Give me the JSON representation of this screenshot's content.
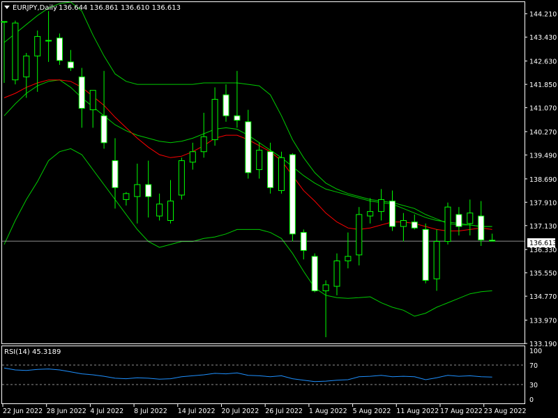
{
  "symbol_label": "EURJPY,Daily",
  "ohlc_readout": "136.644 136.861 136.610 136.613",
  "current_price_label": "136.613",
  "rsi_label": "RSI(14) 45.3189",
  "colors": {
    "background": "#000000",
    "foreground": "#ffffff",
    "bull_body": "#000000",
    "bear_body": "#ffffff",
    "wick": "#00ff00",
    "bollinger": "#00cc00",
    "moving_average": "#ff0000",
    "rsi_line": "#1e90ff",
    "price_line": "#c0c0c0",
    "rsi_levels": "#c0c0c0"
  },
  "chart_data": [
    {
      "type": "candlestick",
      "title": "EURJPY,Daily",
      "ylim": [
        133.19,
        144.6
      ],
      "y_ticks": [
        "144.210",
        "143.430",
        "142.630",
        "141.850",
        "141.070",
        "140.270",
        "139.490",
        "138.690",
        "137.910",
        "137.130",
        "136.330",
        "135.550",
        "134.770",
        "133.970",
        "133.190"
      ],
      "x_ticks": [
        "22 Jun 2022",
        "28 Jun 2022",
        "4 Jul 2022",
        "8 Jul 2022",
        "14 Jul 2022",
        "20 Jul 2022",
        "26 Jul 2022",
        "1 Aug 2022",
        "5 Aug 2022",
        "11 Aug 2022",
        "17 Aug 2022",
        "23 Aug 2022"
      ],
      "candles": [
        {
          "o": 143.95,
          "h": 143.95,
          "l": 141.9,
          "c": 143.95
        },
        {
          "o": 142.0,
          "h": 143.98,
          "l": 141.85,
          "c": 143.9
        },
        {
          "o": 142.1,
          "h": 142.9,
          "l": 141.4,
          "c": 142.8
        },
        {
          "o": 142.8,
          "h": 143.65,
          "l": 141.6,
          "c": 143.45
        },
        {
          "o": 143.3,
          "h": 144.3,
          "l": 142.6,
          "c": 143.32
        },
        {
          "o": 143.4,
          "h": 143.55,
          "l": 142.5,
          "c": 142.65
        },
        {
          "o": 142.6,
          "h": 143.0,
          "l": 142.3,
          "c": 142.4
        },
        {
          "o": 142.1,
          "h": 142.4,
          "l": 140.4,
          "c": 141.05
        },
        {
          "o": 141.0,
          "h": 141.6,
          "l": 140.4,
          "c": 141.65
        },
        {
          "o": 140.8,
          "h": 142.3,
          "l": 139.7,
          "c": 139.9
        },
        {
          "o": 139.3,
          "h": 140.05,
          "l": 137.7,
          "c": 138.4
        },
        {
          "o": 138.0,
          "h": 138.25,
          "l": 137.8,
          "c": 138.2
        },
        {
          "o": 138.1,
          "h": 139.2,
          "l": 137.2,
          "c": 138.5
        },
        {
          "o": 138.5,
          "h": 139.3,
          "l": 137.4,
          "c": 138.1
        },
        {
          "o": 137.45,
          "h": 138.2,
          "l": 137.3,
          "c": 137.85
        },
        {
          "o": 137.3,
          "h": 138.65,
          "l": 137.2,
          "c": 137.95
        },
        {
          "o": 138.15,
          "h": 139.4,
          "l": 138.0,
          "c": 139.3
        },
        {
          "o": 139.25,
          "h": 139.9,
          "l": 139.0,
          "c": 139.6
        },
        {
          "o": 139.6,
          "h": 140.9,
          "l": 139.4,
          "c": 140.1
        },
        {
          "o": 140.0,
          "h": 141.75,
          "l": 139.8,
          "c": 141.35
        },
        {
          "o": 141.5,
          "h": 141.85,
          "l": 140.6,
          "c": 140.8
        },
        {
          "o": 140.8,
          "h": 142.3,
          "l": 140.4,
          "c": 140.65
        },
        {
          "o": 140.6,
          "h": 141.0,
          "l": 138.7,
          "c": 138.9
        },
        {
          "o": 139.0,
          "h": 139.9,
          "l": 138.7,
          "c": 139.65
        },
        {
          "o": 139.6,
          "h": 139.9,
          "l": 138.2,
          "c": 138.4
        },
        {
          "o": 138.3,
          "h": 139.6,
          "l": 138.2,
          "c": 139.4
        },
        {
          "o": 139.5,
          "h": 139.55,
          "l": 136.6,
          "c": 136.85
        },
        {
          "o": 136.9,
          "h": 137.0,
          "l": 136.0,
          "c": 136.3
        },
        {
          "o": 136.1,
          "h": 136.2,
          "l": 134.9,
          "c": 134.95
        },
        {
          "o": 134.95,
          "h": 135.3,
          "l": 133.4,
          "c": 135.15
        },
        {
          "o": 135.1,
          "h": 136.2,
          "l": 134.8,
          "c": 135.95
        },
        {
          "o": 135.95,
          "h": 136.9,
          "l": 135.7,
          "c": 136.1
        },
        {
          "o": 136.15,
          "h": 137.75,
          "l": 135.8,
          "c": 137.5
        },
        {
          "o": 137.45,
          "h": 138.05,
          "l": 137.2,
          "c": 137.6
        },
        {
          "o": 137.6,
          "h": 138.35,
          "l": 137.3,
          "c": 138.0
        },
        {
          "o": 137.95,
          "h": 138.3,
          "l": 136.95,
          "c": 137.1
        },
        {
          "o": 137.1,
          "h": 137.55,
          "l": 136.6,
          "c": 137.3
        },
        {
          "o": 137.25,
          "h": 137.5,
          "l": 137.0,
          "c": 137.05
        },
        {
          "o": 137.0,
          "h": 137.2,
          "l": 135.2,
          "c": 135.3
        },
        {
          "o": 135.35,
          "h": 137.0,
          "l": 134.95,
          "c": 136.6
        },
        {
          "o": 136.6,
          "h": 137.9,
          "l": 136.5,
          "c": 137.75
        },
        {
          "o": 137.5,
          "h": 137.75,
          "l": 136.8,
          "c": 137.1
        },
        {
          "o": 137.2,
          "h": 138.0,
          "l": 136.8,
          "c": 137.55
        },
        {
          "o": 137.45,
          "h": 137.95,
          "l": 136.45,
          "c": 136.65
        },
        {
          "o": 136.64,
          "h": 136.86,
          "l": 136.61,
          "c": 136.61
        }
      ],
      "moving_average": [
        141.4,
        141.55,
        141.75,
        141.9,
        142.0,
        142.0,
        141.95,
        141.75,
        141.45,
        141.15,
        140.75,
        140.4,
        140.05,
        139.75,
        139.5,
        139.4,
        139.45,
        139.6,
        139.8,
        140.05,
        140.15,
        140.15,
        140.0,
        139.8,
        139.6,
        139.3,
        138.8,
        138.3,
        137.95,
        137.55,
        137.25,
        137.05,
        137.0,
        137.05,
        137.15,
        137.25,
        137.25,
        137.2,
        137.1,
        137.0,
        136.95,
        136.95,
        137.0,
        137.05,
        137.0
      ],
      "bollinger_upper": [
        143.25,
        143.55,
        143.85,
        144.15,
        144.4,
        144.55,
        144.6,
        144.3,
        143.5,
        142.8,
        142.2,
        141.95,
        141.85,
        141.85,
        141.85,
        141.85,
        141.85,
        141.85,
        141.9,
        141.9,
        141.9,
        141.9,
        141.85,
        141.8,
        141.5,
        140.8,
        140.0,
        139.4,
        138.9,
        138.55,
        138.35,
        138.2,
        138.1,
        138.0,
        137.95,
        137.9,
        137.8,
        137.7,
        137.5,
        137.35,
        137.2,
        137.15,
        137.15,
        137.1,
        137.1
      ],
      "bollinger_middle": [
        140.8,
        141.2,
        141.55,
        141.8,
        141.95,
        142.0,
        141.75,
        141.4,
        141.1,
        140.8,
        140.5,
        140.3,
        140.15,
        140.05,
        139.95,
        139.9,
        139.95,
        140.05,
        140.2,
        140.35,
        140.4,
        140.35,
        140.15,
        139.9,
        139.65,
        139.4,
        139.1,
        138.8,
        138.55,
        138.35,
        138.25,
        138.15,
        138.05,
        137.95,
        137.9,
        137.85,
        137.7,
        137.55,
        137.4,
        137.3,
        137.25,
        137.2,
        137.15,
        137.1,
        137.1
      ],
      "bollinger_lower": [
        136.5,
        137.3,
        138.0,
        138.6,
        139.3,
        139.6,
        139.7,
        139.5,
        139.0,
        138.5,
        138.0,
        137.5,
        137.0,
        136.6,
        136.4,
        136.5,
        136.6,
        136.6,
        136.7,
        136.75,
        136.85,
        137.0,
        137.0,
        137.0,
        136.9,
        136.7,
        136.2,
        135.6,
        135.05,
        134.8,
        134.72,
        134.7,
        134.72,
        134.75,
        134.55,
        134.4,
        134.3,
        134.1,
        134.2,
        134.4,
        134.55,
        134.7,
        134.85,
        134.92,
        134.95
      ]
    },
    {
      "type": "line",
      "title": "RSI(14) 45.3189",
      "ylim": [
        0,
        100
      ],
      "y_ticks": [
        "100",
        "70",
        "30",
        "0"
      ],
      "levels": [
        70,
        30
      ],
      "series": [
        {
          "name": "RSI(14)",
          "values": [
            64,
            60,
            59,
            61,
            62,
            60,
            56,
            52,
            50,
            47,
            43,
            42,
            44,
            43,
            41,
            42,
            46,
            48,
            50,
            53,
            52,
            54,
            49,
            48,
            46,
            48,
            42,
            39,
            36,
            37,
            39,
            40,
            46,
            47,
            49,
            46,
            47,
            46,
            40,
            44,
            49,
            47,
            48,
            46,
            45.3
          ]
        }
      ]
    }
  ]
}
